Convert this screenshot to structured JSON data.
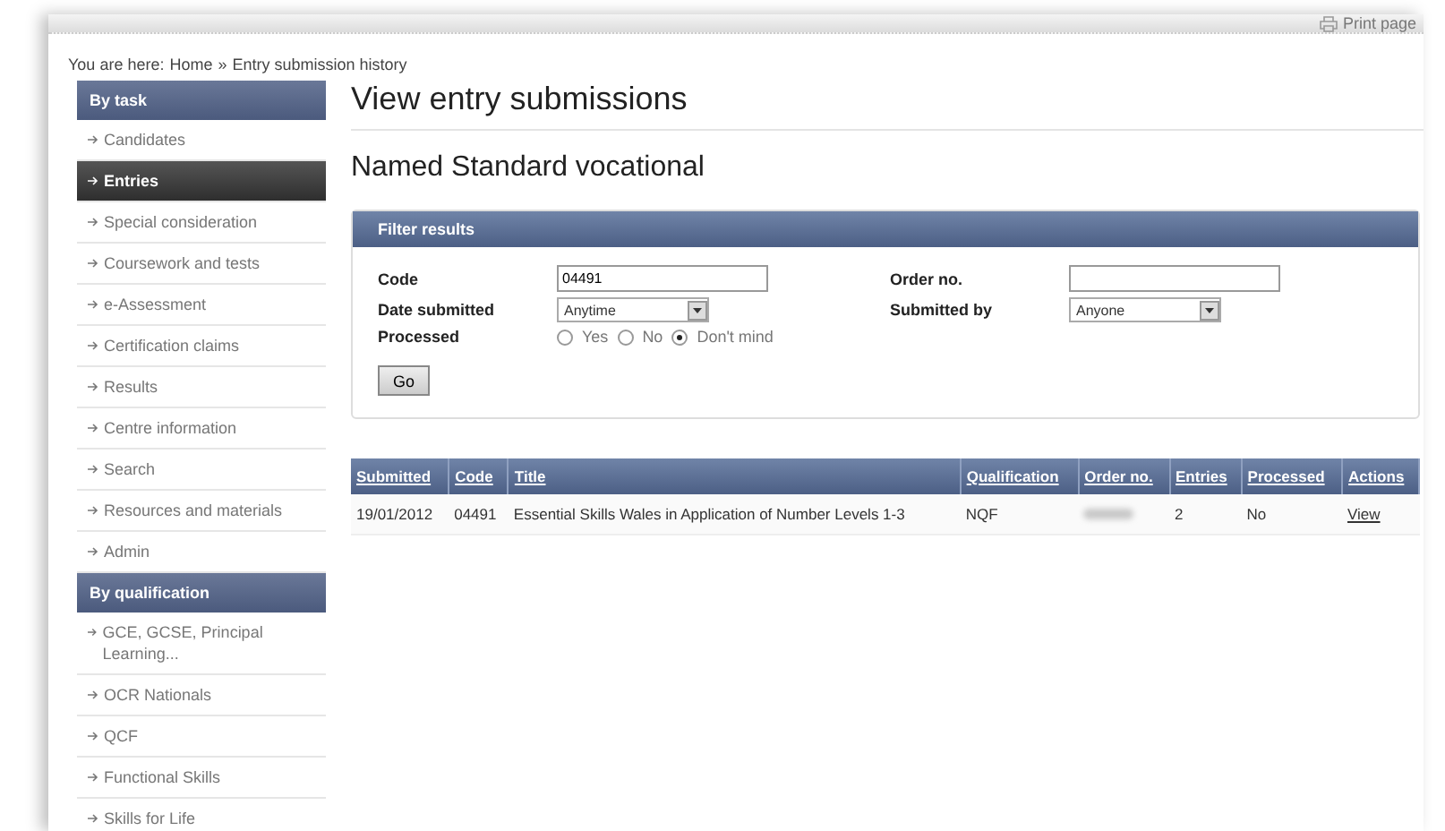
{
  "header": {
    "print_link": "Print page"
  },
  "breadcrumb": {
    "prefix": "You are here:",
    "items": [
      "Home",
      "Entry submission history"
    ],
    "separator": "»"
  },
  "sidebar": {
    "sections": [
      {
        "title": "By task",
        "items": [
          {
            "label": "Candidates",
            "selected": false
          },
          {
            "label": "Entries",
            "selected": true
          },
          {
            "label": "Special consideration",
            "selected": false
          },
          {
            "label": "Coursework and tests",
            "selected": false
          },
          {
            "label": "e-Assessment",
            "selected": false
          },
          {
            "label": "Certification claims",
            "selected": false
          },
          {
            "label": "Results",
            "selected": false
          },
          {
            "label": "Centre information",
            "selected": false
          },
          {
            "label": "Search",
            "selected": false
          },
          {
            "label": "Resources and materials",
            "selected": false
          },
          {
            "label": "Admin",
            "selected": false
          }
        ]
      },
      {
        "title": "By qualification",
        "items": [
          {
            "label": "GCE, GCSE, Principal Learning...",
            "selected": false
          },
          {
            "label": "OCR Nationals",
            "selected": false
          },
          {
            "label": "QCF",
            "selected": false
          },
          {
            "label": "Functional Skills",
            "selected": false
          },
          {
            "label": "Skills for Life",
            "selected": false
          }
        ]
      }
    ]
  },
  "page_title": "View entry submissions",
  "subtitle": "Named Standard vocational",
  "filter": {
    "title": "Filter results",
    "code": {
      "label": "Code",
      "value": "04491"
    },
    "order_no": {
      "label": "Order no."
    },
    "date_submitted": {
      "label": "Date submitted",
      "value": "Anytime"
    },
    "submitted_by": {
      "label": "Submitted by",
      "value": "Anyone"
    },
    "processed": {
      "label": "Processed",
      "options": [
        {
          "label": "Yes",
          "selected": false
        },
        {
          "label": "No",
          "selected": false
        },
        {
          "label": "Don't mind",
          "selected": true
        }
      ]
    },
    "button": "Go"
  },
  "table": {
    "columns": [
      "Submitted",
      "Code",
      "Title",
      "Qualification",
      "Order no.",
      "Entries",
      "Processed",
      "Actions"
    ],
    "rows": [
      {
        "submitted": "19/01/2012",
        "code": "04491",
        "title": "Essential Skills Wales in Application of Number Levels 1-3",
        "qualification": "NQF",
        "order_no_redacted": true,
        "entries": "2",
        "processed": "No",
        "action": "View"
      }
    ]
  }
}
